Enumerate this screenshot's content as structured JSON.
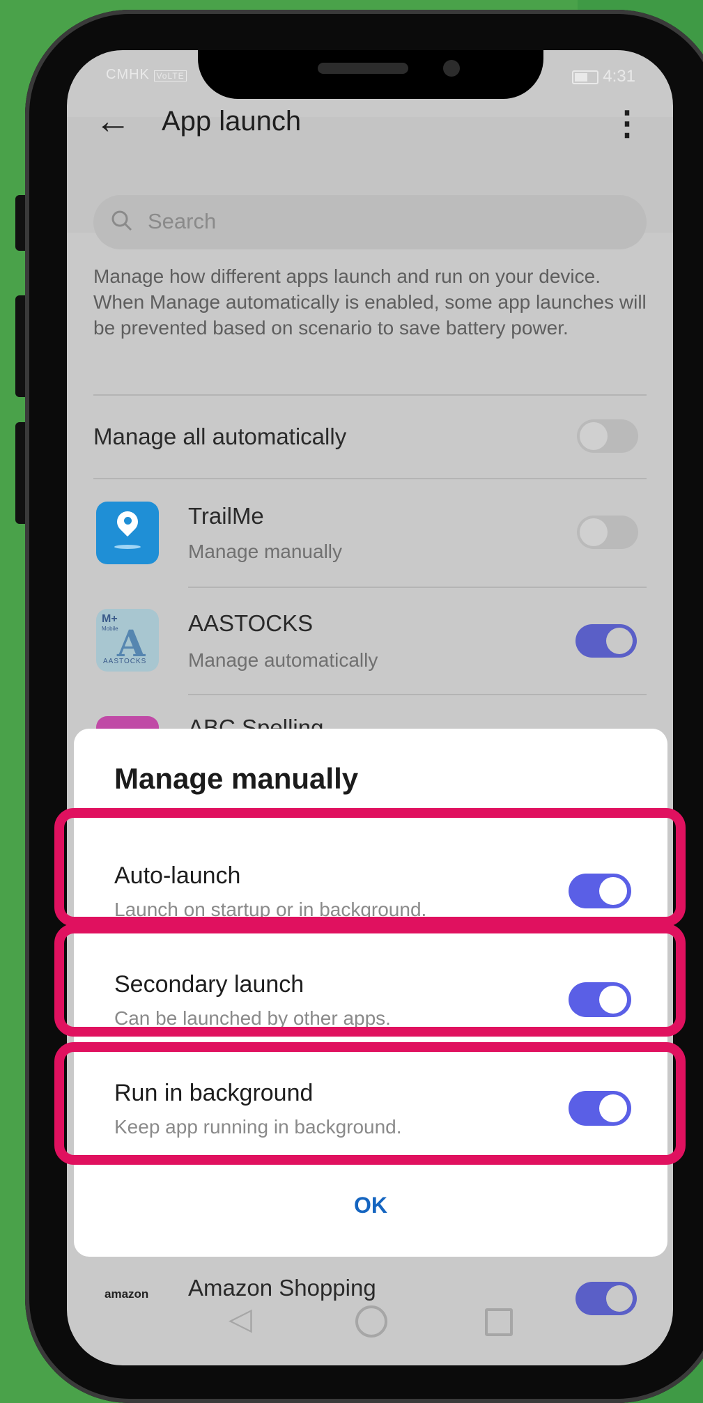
{
  "status_bar": {
    "carrier": "CMHK",
    "volte_badge": "VoLTE",
    "time": "4:31"
  },
  "header": {
    "title": "App launch",
    "back_icon": "arrow-left-icon",
    "more_icon": "more-vertical-icon"
  },
  "search": {
    "placeholder": "Search"
  },
  "description": "Manage how different apps launch and run on your device. When Manage automatically is enabled, some app launches will be prevented based on scenario to save battery power.",
  "manage_all": {
    "label": "Manage all automatically",
    "enabled": false
  },
  "apps": [
    {
      "name": "TrailMe",
      "mode": "Manage manually",
      "enabled": false
    },
    {
      "name": "AASTOCKS",
      "mode": "Manage automatically",
      "enabled": true,
      "icon_text_top": "M+",
      "icon_text_small": "Mobile",
      "icon_text_bottom": "AASTOCKS"
    },
    {
      "name": "ABC Spelling"
    },
    {
      "name": "Amazon Shopping",
      "icon_text": "amazon",
      "enabled": true
    }
  ],
  "dialog": {
    "title": "Manage manually",
    "items": [
      {
        "label": "Auto-launch",
        "description": "Launch on startup or in background.",
        "enabled": true
      },
      {
        "label": "Secondary launch",
        "description": "Can be launched by other apps.",
        "enabled": true
      },
      {
        "label": "Run in background",
        "description": "Keep app running in background.",
        "enabled": true
      }
    ],
    "ok_label": "OK"
  },
  "highlight_color": "#e0115f",
  "accent_color": "#5a5fe6"
}
